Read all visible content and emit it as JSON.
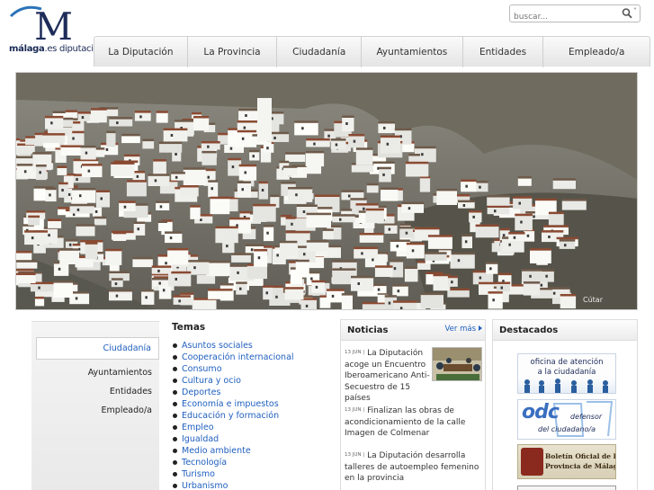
{
  "logo": {
    "letter": "M",
    "text_bold": "málaga",
    "text_rest": ".es diputación"
  },
  "search": {
    "placeholder": "buscar...",
    "icon": "search-icon",
    "caret": "˅"
  },
  "nav": {
    "items": [
      "La Diputación",
      "La Provincia",
      "Ciudadanía",
      "Ayuntamientos",
      "Entidades",
      "Empleado/a"
    ]
  },
  "hero": {
    "credit": "Cútar"
  },
  "sidebar": {
    "items": [
      {
        "label": "Ciudadanía",
        "active": true
      },
      {
        "label": "Ayuntamientos",
        "active": false
      },
      {
        "label": "Entidades",
        "active": false
      },
      {
        "label": "Empleado/a",
        "active": false
      }
    ]
  },
  "temas": {
    "title": "Temas",
    "items": [
      "Asuntos sociales",
      "Cooperación internacional",
      "Consumo",
      "Cultura y ocio",
      "Deportes",
      "Economía e impuestos",
      "Educación y formación",
      "Empleo",
      "Igualdad",
      "Medio ambiente",
      "Tecnología",
      "Turismo",
      "Urbanismo"
    ]
  },
  "noticias": {
    "title": "Noticias",
    "ver_mas": "Ver más",
    "items": [
      {
        "date": "13 JUN |",
        "text": "La Diputación acoge un Encuentro Iberoamericano Anti-Secuestro de 15 países"
      },
      {
        "date": "13 JUN |",
        "text": "Finalizan las obras de acondicionamiento de la calle Imagen de Colmenar"
      },
      {
        "date": "13 JUN |",
        "text": "La Diputación desarrolla talleres de autoempleo femenino en la provincia"
      }
    ]
  },
  "destacados": {
    "title": "Destacados",
    "banner1": {
      "line1": "oficina de atención",
      "line2": "a la ciudadanía"
    },
    "banner2": {
      "acronym": "odc",
      "line1": "defensor",
      "line2": "del ciudadano/a"
    },
    "banner3": {
      "line1": "Boletín Oficial de la",
      "line2": "Provincia de Málaga"
    }
  },
  "colors": {
    "link": "#1f5fbf",
    "brand_navy": "#1e2c5a",
    "brand_blue": "#2a73b8"
  }
}
